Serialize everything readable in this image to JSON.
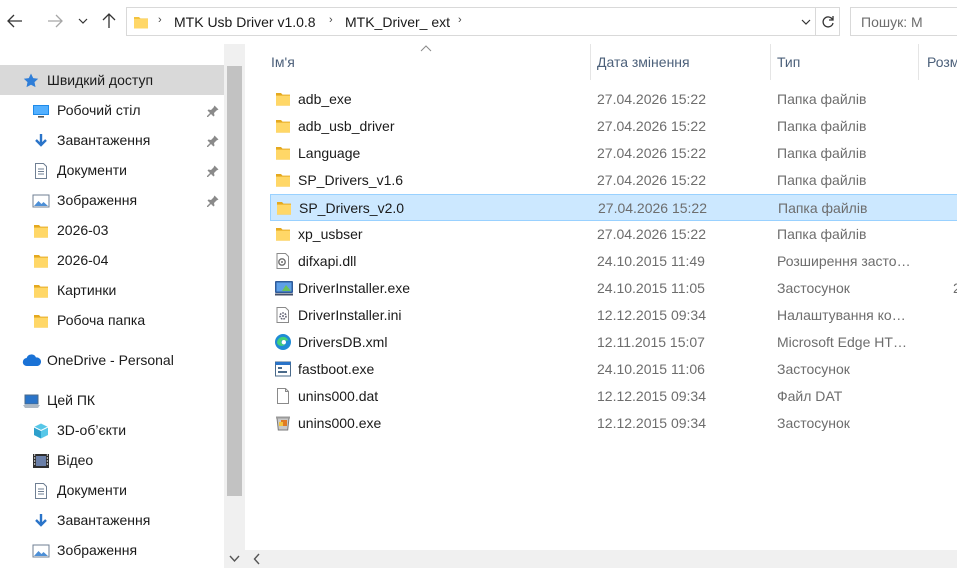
{
  "navigation": {
    "back": "←",
    "forward": "→",
    "recent": "⌄",
    "up": "↑"
  },
  "address_bar": {
    "crumbs": [
      "MTK Usb Driver v1.0.8",
      "MTK_Driver_ ext"
    ],
    "separator": "›"
  },
  "search": {
    "placeholder": "Пошук: M"
  },
  "sidebar": {
    "items": [
      {
        "label": "Швидкий доступ",
        "icon": "star-icon"
      },
      {
        "label": "Робочий стіл",
        "icon": "desktop-icon",
        "pinned": true
      },
      {
        "label": "Завантаження",
        "icon": "download-icon",
        "pinned": true
      },
      {
        "label": "Документи",
        "icon": "document-icon",
        "pinned": true
      },
      {
        "label": "Зображення",
        "icon": "pictures-icon",
        "pinned": true
      },
      {
        "label": "2026-03",
        "icon": "folder-icon"
      },
      {
        "label": "2026-04",
        "icon": "folder-icon"
      },
      {
        "label": "Картинки",
        "icon": "folder-icon"
      },
      {
        "label": "Робоча папка",
        "icon": "folder-icon"
      },
      {
        "label": "OneDrive - Personal",
        "icon": "cloud-icon"
      },
      {
        "label": "Цей ПК",
        "icon": "computer-icon"
      },
      {
        "label": "3D-об’єкти",
        "icon": "3d-objects-icon"
      },
      {
        "label": "Відео",
        "icon": "video-icon"
      },
      {
        "label": "Документи",
        "icon": "document-icon"
      },
      {
        "label": "Завантаження",
        "icon": "download-icon"
      },
      {
        "label": "Зображення",
        "icon": "pictures-icon"
      }
    ]
  },
  "columns": {
    "name": "Ім'я",
    "date": "Дата змінення",
    "type": "Тип",
    "size": "Розм"
  },
  "files": [
    {
      "name": "adb_exe",
      "date": "27.04.2026 15:22",
      "type": "Папка файлів",
      "size": "",
      "icon": "folder-icon"
    },
    {
      "name": "adb_usb_driver",
      "date": "27.04.2026 15:22",
      "type": "Папка файлів",
      "size": "",
      "icon": "folder-icon"
    },
    {
      "name": "Language",
      "date": "27.04.2026 15:22",
      "type": "Папка файлів",
      "size": "",
      "icon": "folder-icon"
    },
    {
      "name": "SP_Drivers_v1.6",
      "date": "27.04.2026 15:22",
      "type": "Папка файлів",
      "size": "",
      "icon": "folder-icon"
    },
    {
      "name": "SP_Drivers_v2.0",
      "date": "27.04.2026 15:22",
      "type": "Папка файлів",
      "size": "",
      "icon": "folder-icon",
      "selected": true
    },
    {
      "name": "xp_usbser",
      "date": "27.04.2026 15:22",
      "type": "Папка файлів",
      "size": "",
      "icon": "folder-icon"
    },
    {
      "name": "difxapi.dll",
      "date": "24.10.2015 11:49",
      "type": "Розширення застосунку",
      "size": "",
      "icon": "dll-icon"
    },
    {
      "name": "DriverInstaller.exe",
      "date": "24.10.2015 11:05",
      "type": "Застосунок",
      "size": "2",
      "icon": "installer-icon"
    },
    {
      "name": "DriverInstaller.ini",
      "date": "12.12.2015 09:34",
      "type": "Налаштування конфігурації",
      "size": "",
      "icon": "settings-file-icon"
    },
    {
      "name": "DriversDB.xml",
      "date": "12.11.2015 15:07",
      "type": "Microsoft Edge HTML Document",
      "size": "",
      "icon": "edge-icon"
    },
    {
      "name": "fastboot.exe",
      "date": "24.10.2015 11:06",
      "type": "Застосунок",
      "size": "",
      "icon": "exe-icon"
    },
    {
      "name": "unins000.dat",
      "date": "12.12.2015 09:34",
      "type": "Файл DAT",
      "size": "",
      "icon": "blank-file-icon"
    },
    {
      "name": "unins000.exe",
      "date": "12.12.2015 09:34",
      "type": "Застосунок",
      "size": "",
      "icon": "uninstaller-icon"
    }
  ],
  "colors": {
    "selected_row": "#cce8ff",
    "selected_sidebar": "#d9d9d9",
    "folder": "#f3c33f",
    "header_text": "#4c607a"
  }
}
